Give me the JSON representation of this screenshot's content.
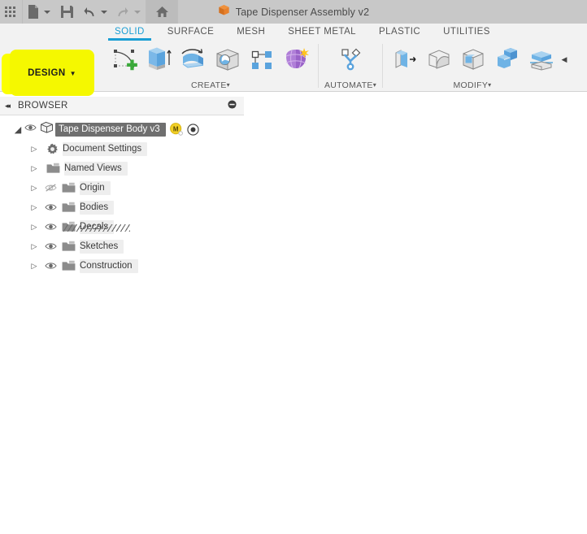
{
  "window": {
    "document_title": "Tape Dispenser Assembly v2",
    "document_icon": "cube-icon"
  },
  "quick_access": {
    "items": [
      {
        "name": "app-grid-icon",
        "label": "Show Data Panel"
      },
      {
        "name": "file-icon",
        "label": "File"
      },
      {
        "name": "save-icon",
        "label": "Save"
      },
      {
        "name": "undo-icon",
        "label": "Undo"
      },
      {
        "name": "redo-icon",
        "label": "Redo"
      },
      {
        "name": "home-icon",
        "label": "Home"
      }
    ]
  },
  "workspace": {
    "selector_label": "DESIGN",
    "caret": "▼",
    "highlight_color": "#f5f800"
  },
  "ribbon": {
    "tabs": [
      {
        "label": "SOLID",
        "active": true
      },
      {
        "label": "SURFACE",
        "active": false
      },
      {
        "label": "MESH",
        "active": false
      },
      {
        "label": "SHEET METAL",
        "active": false
      },
      {
        "label": "PLASTIC",
        "active": false
      },
      {
        "label": "UTILITIES",
        "active": false
      }
    ],
    "active_tab_color": "#1a9ed4",
    "panels": [
      {
        "title": "CREATE",
        "caret": "▾",
        "tools": [
          {
            "name": "create-sketch-icon",
            "label": "Create Sketch"
          },
          {
            "name": "extrude-icon",
            "label": "Extrude"
          },
          {
            "name": "revolve-icon",
            "label": "Revolve"
          },
          {
            "name": "hole-icon",
            "label": "Hole"
          },
          {
            "name": "pattern-icon",
            "label": "Pattern"
          },
          {
            "name": "create-form-icon",
            "label": "Create Form"
          }
        ]
      },
      {
        "title": "AUTOMATE",
        "caret": "▾",
        "tools": [
          {
            "name": "automate-icon",
            "label": "Automate"
          }
        ]
      },
      {
        "title": "MODIFY",
        "caret": "▾",
        "tools": [
          {
            "name": "press-pull-icon",
            "label": "Press Pull"
          },
          {
            "name": "fillet-icon",
            "label": "Fillet"
          },
          {
            "name": "shell-icon",
            "label": "Shell"
          },
          {
            "name": "combine-icon",
            "label": "Combine"
          },
          {
            "name": "split-body-icon",
            "label": "Split Body"
          }
        ],
        "overflow": "◀"
      }
    ]
  },
  "browser": {
    "title": "BROWSER",
    "collapse_icon": "◂◂",
    "minimize_icon": "minus-circle-icon",
    "root": {
      "label": "Tape Dispenser Body v3",
      "expander": "◢",
      "visibility_icon": "eye-icon",
      "component_icon": "component-icon",
      "badge_label": "M",
      "badge_color": "#f2d027",
      "activate_icon": "target-icon"
    },
    "items": [
      {
        "label": "Document Settings",
        "icon": "gear-icon",
        "expander": "▷",
        "visibility": "none",
        "hatched": false
      },
      {
        "label": "Named Views",
        "icon": "folder-icon",
        "expander": "▷",
        "visibility": "none",
        "hatched": false
      },
      {
        "label": "Origin",
        "icon": "folder-icon",
        "expander": "▷",
        "visibility": "hidden",
        "hatched": false
      },
      {
        "label": "Bodies",
        "icon": "folder-icon",
        "expander": "▷",
        "visibility": "visible",
        "hatched": false
      },
      {
        "label": "Decals",
        "icon": "folder-icon",
        "expander": "▷",
        "visibility": "visible",
        "hatched": true
      },
      {
        "label": "Sketches",
        "icon": "folder-icon",
        "expander": "▷",
        "visibility": "visible",
        "hatched": false
      },
      {
        "label": "Construction",
        "icon": "folder-icon",
        "expander": "▷",
        "visibility": "visible",
        "hatched": false
      }
    ]
  }
}
